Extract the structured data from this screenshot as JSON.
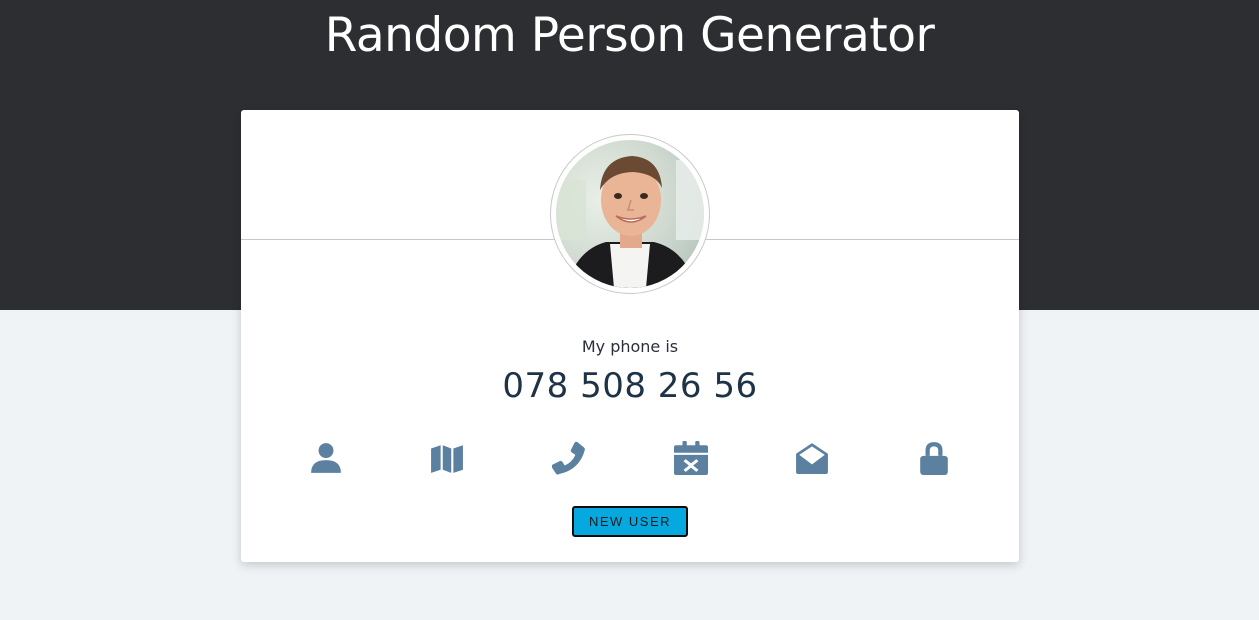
{
  "header": {
    "title": "Random Person Generator"
  },
  "profile": {
    "avatar_icon": "user-photo",
    "info_label": "My phone is",
    "info_value": "078 508 26 56"
  },
  "actions": {
    "icons": [
      {
        "name": "user-icon",
        "label": "name"
      },
      {
        "name": "map-icon",
        "label": "location"
      },
      {
        "name": "phone-icon",
        "label": "phone"
      },
      {
        "name": "calendar-icon",
        "label": "birthday"
      },
      {
        "name": "envelope-open-icon",
        "label": "email"
      },
      {
        "name": "lock-icon",
        "label": "password"
      }
    ],
    "button_label": "NEW USER"
  },
  "colors": {
    "header_bg": "#2c2e31",
    "page_bg": "#eff3f6",
    "icon_color": "#5b80a0",
    "button_bg": "#06a8e0"
  }
}
